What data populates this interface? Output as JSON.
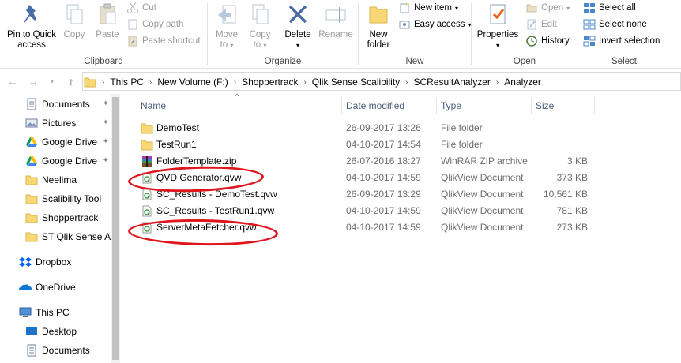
{
  "ribbon": {
    "clipboard": {
      "label": "Clipboard",
      "pin_label_1": "Pin to Quick",
      "pin_label_2": "access",
      "copy": "Copy",
      "paste": "Paste",
      "cut": "Cut",
      "copy_path": "Copy path",
      "paste_shortcut": "Paste shortcut"
    },
    "organize": {
      "label": "Organize",
      "move_to_1": "Move",
      "move_to_2": "to",
      "copy_to_1": "Copy",
      "copy_to_2": "to",
      "delete": "Delete",
      "rename": "Rename"
    },
    "new": {
      "label": "New",
      "new_folder_1": "New",
      "new_folder_2": "folder",
      "new_item": "New item",
      "easy_access": "Easy access"
    },
    "open": {
      "label": "Open",
      "properties": "Properties",
      "open": "Open",
      "edit": "Edit",
      "history": "History"
    },
    "select": {
      "label": "Select",
      "select_all": "Select all",
      "select_none": "Select none",
      "invert_selection": "Invert selection"
    }
  },
  "address": {
    "crumbs": [
      "This PC",
      "New Volume (F:)",
      "Shoppertrack",
      "Qlik Sense Scalibility",
      "SCResultAnalyzer",
      "Analyzer"
    ]
  },
  "nav": {
    "items": [
      {
        "label": "Documents",
        "icon": "documents-icon",
        "pinned": true
      },
      {
        "label": "Pictures",
        "icon": "pictures-icon",
        "pinned": true
      },
      {
        "label": "Google Drive",
        "icon": "google-drive-icon",
        "pinned": true
      },
      {
        "label": "Google Drive",
        "icon": "google-drive-icon",
        "pinned": true
      },
      {
        "label": "Neelima",
        "icon": "folder-icon",
        "pinned": false
      },
      {
        "label": "Scalibility Tool",
        "icon": "folder-icon",
        "pinned": false
      },
      {
        "label": "Shoppertrack",
        "icon": "folder-icon",
        "pinned": false
      },
      {
        "label": "ST Qlik Sense Ap",
        "icon": "folder-icon",
        "pinned": false
      },
      {
        "label": "Dropbox",
        "icon": "dropbox-icon",
        "pinned": false
      },
      {
        "label": "OneDrive",
        "icon": "onedrive-icon",
        "pinned": false
      },
      {
        "label": "This PC",
        "icon": "this-pc-icon",
        "pinned": false
      },
      {
        "label": "Desktop",
        "icon": "desktop-icon",
        "pinned": false
      },
      {
        "label": "Documents",
        "icon": "documents-icon",
        "pinned": false
      }
    ]
  },
  "files": {
    "columns": {
      "name": "Name",
      "date": "Date modified",
      "type": "Type",
      "size": "Size"
    },
    "rows": [
      {
        "name": "DemoTest",
        "date": "26-09-2017 13:26",
        "type": "File folder",
        "size": "",
        "icon": "folder-icon"
      },
      {
        "name": "TestRun1",
        "date": "04-10-2017 14:54",
        "type": "File folder",
        "size": "",
        "icon": "folder-icon"
      },
      {
        "name": "FolderTemplate.zip",
        "date": "26-07-2016 18:27",
        "type": "WinRAR ZIP archive",
        "size": "3 KB",
        "icon": "zip-icon"
      },
      {
        "name": "QVD Generator.qvw",
        "date": "04-10-2017 14:59",
        "type": "QlikView Document",
        "size": "373 KB",
        "icon": "qlikview-icon"
      },
      {
        "name": "SC_Results - DemoTest.qvw",
        "date": "26-09-2017 13:29",
        "type": "QlikView Document",
        "size": "10,561 KB",
        "icon": "qlikview-icon"
      },
      {
        "name": "SC_Results - TestRun1.qvw",
        "date": "04-10-2017 14:59",
        "type": "QlikView Document",
        "size": "781 KB",
        "icon": "qlikview-icon"
      },
      {
        "name": "ServerMetaFetcher.qvw",
        "date": "04-10-2017 14:59",
        "type": "QlikView Document",
        "size": "273 KB",
        "icon": "qlikview-icon"
      }
    ]
  },
  "colors": {
    "folder": "#f8d775",
    "accent": "#0078d7",
    "annotation": "#e0161e"
  }
}
